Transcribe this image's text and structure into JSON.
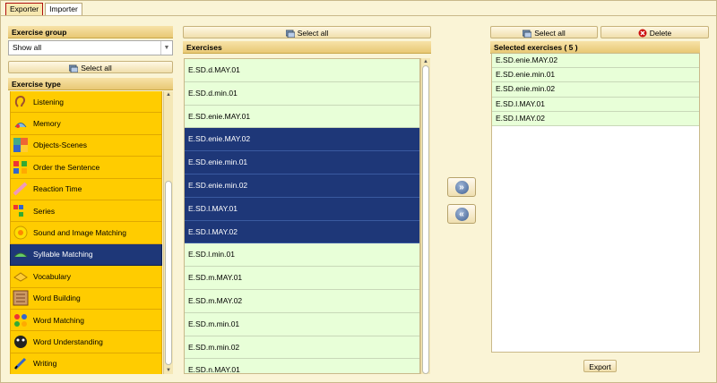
{
  "tabs": [
    {
      "label": "Exporter",
      "active": true
    },
    {
      "label": "Importer",
      "active": false
    }
  ],
  "left": {
    "group_header": "Exercise group",
    "group_select_value": "Show all",
    "select_all_label": "Select all",
    "type_header": "Exercise type",
    "types": [
      {
        "label": "Listening",
        "icon": "ear-icon",
        "selected": false
      },
      {
        "label": "Memory",
        "icon": "memory-icon",
        "selected": false
      },
      {
        "label": "Objects-Scenes",
        "icon": "objects-scenes-icon",
        "selected": false
      },
      {
        "label": "Order the Sentence",
        "icon": "order-sentence-icon",
        "selected": false
      },
      {
        "label": "Reaction Time",
        "icon": "reaction-time-icon",
        "selected": false
      },
      {
        "label": "Series",
        "icon": "series-icon",
        "selected": false
      },
      {
        "label": "Sound and Image Matching",
        "icon": "sound-image-icon",
        "selected": false
      },
      {
        "label": "Syllable Matching",
        "icon": "syllable-icon",
        "selected": true
      },
      {
        "label": "Vocabulary",
        "icon": "vocabulary-icon",
        "selected": false
      },
      {
        "label": "Word Building",
        "icon": "word-building-icon",
        "selected": false
      },
      {
        "label": "Word Matching",
        "icon": "word-matching-icon",
        "selected": false
      },
      {
        "label": "Word Understanding",
        "icon": "word-understanding-icon",
        "selected": false
      },
      {
        "label": "Writing",
        "icon": "writing-icon",
        "selected": false
      }
    ]
  },
  "middle": {
    "select_all_label": "Select all",
    "header": "Exercises",
    "exercises": [
      {
        "label": "E.SD.d.MAY.01",
        "selected": false
      },
      {
        "label": "E.SD.d.min.01",
        "selected": false
      },
      {
        "label": "E.SD.enie.MAY.01",
        "selected": false
      },
      {
        "label": "E.SD.enie.MAY.02",
        "selected": true
      },
      {
        "label": "E.SD.enie.min.01",
        "selected": true
      },
      {
        "label": "E.SD.enie.min.02",
        "selected": true
      },
      {
        "label": "E.SD.l.MAY.01",
        "selected": true
      },
      {
        "label": "E.SD.l.MAY.02",
        "selected": true
      },
      {
        "label": "E.SD.l.min.01",
        "selected": false
      },
      {
        "label": "E.SD.m.MAY.01",
        "selected": false
      },
      {
        "label": "E.SD.m.MAY.02",
        "selected": false
      },
      {
        "label": "E.SD.m.min.01",
        "selected": false
      },
      {
        "label": "E.SD.m.min.02",
        "selected": false
      },
      {
        "label": "E.SD.n.MAY.01",
        "selected": false
      }
    ],
    "add_icon": "double-chevron-right-icon",
    "remove_icon": "double-chevron-left-icon"
  },
  "right": {
    "select_all_label": "Select all",
    "delete_label": "Delete",
    "header": "Selected exercises ( 5 )",
    "selected": [
      "E.SD.enie.MAY.02",
      "E.SD.enie.min.01",
      "E.SD.enie.min.02",
      "E.SD.l.MAY.01",
      "E.SD.l.MAY.02"
    ],
    "export_label": "Export"
  },
  "colors": {
    "selected": "#1e3778",
    "type_bg": "#ffcc00",
    "exercise_bg": "#e8ffd8",
    "delete_red": "#cc1010"
  }
}
